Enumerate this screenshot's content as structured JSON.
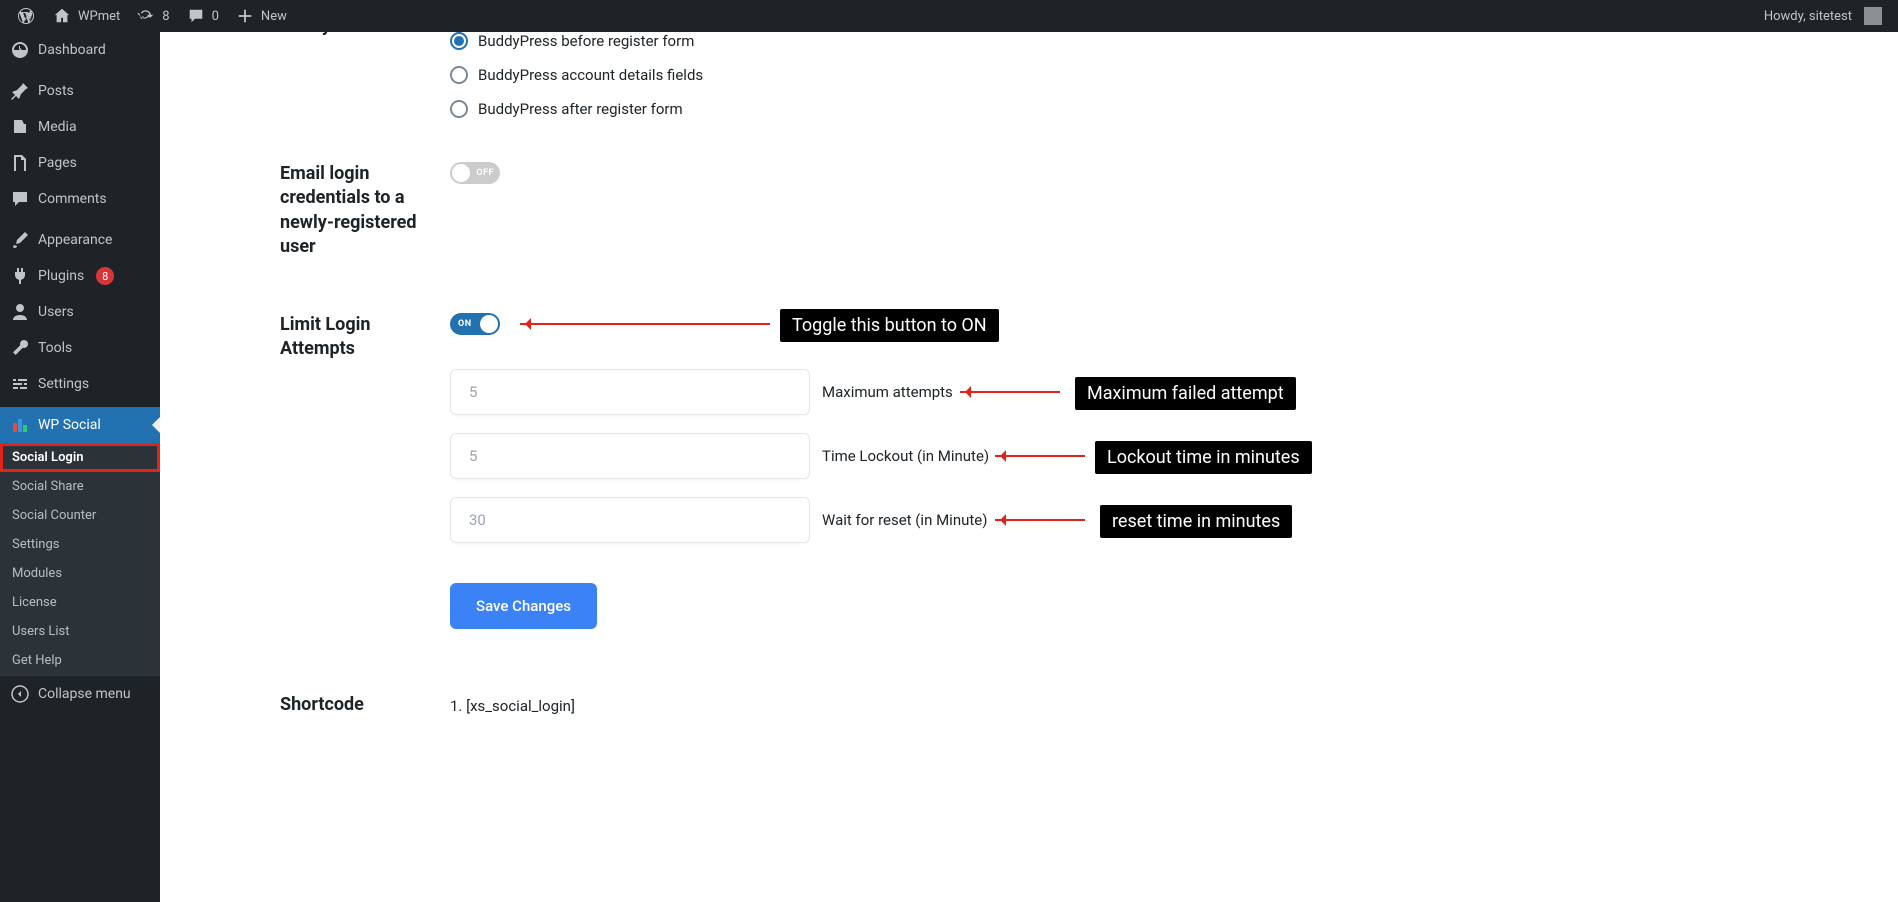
{
  "adminbar": {
    "site_name": "WPmet",
    "updates_count": "8",
    "comments_count": "0",
    "new_label": "New",
    "howdy": "Howdy, sitetest"
  },
  "sidebar": {
    "items": [
      {
        "label": "Dashboard",
        "icon": "dashboard"
      },
      {
        "label": "Posts",
        "icon": "pin"
      },
      {
        "label": "Media",
        "icon": "media"
      },
      {
        "label": "Pages",
        "icon": "pages"
      },
      {
        "label": "Comments",
        "icon": "comment"
      },
      {
        "label": "Appearance",
        "icon": "brush"
      },
      {
        "label": "Plugins",
        "icon": "plug",
        "badge": "8"
      },
      {
        "label": "Users",
        "icon": "user"
      },
      {
        "label": "Tools",
        "icon": "wrench"
      },
      {
        "label": "Settings",
        "icon": "sliders"
      },
      {
        "label": "WP Social",
        "icon": "social",
        "current": true
      }
    ],
    "sub_items": [
      {
        "label": "Social Login",
        "active": true,
        "highlighted": true
      },
      {
        "label": "Social Share"
      },
      {
        "label": "Social Counter"
      },
      {
        "label": "Settings"
      },
      {
        "label": "Modules"
      },
      {
        "label": "License"
      },
      {
        "label": "Users List"
      },
      {
        "label": "Get Help"
      }
    ],
    "collapse_label": "Collapse menu"
  },
  "form": {
    "buddypress_heading": "BuddyPress",
    "bp_option_1": "BuddyPress before register form",
    "bp_option_2": "BuddyPress account details fields",
    "bp_option_3": "BuddyPress after register form",
    "email_login_label": "Email login credentials to a newly-registered user",
    "toggle_off_text": "OFF",
    "limit_login_label": "Limit Login Attempts",
    "toggle_on_text": "ON",
    "max_attempts_placeholder": "5",
    "max_attempts_label": "Maximum attempts",
    "time_lockout_placeholder": "5",
    "time_lockout_label": "Time Lockout (in Minute)",
    "wait_reset_placeholder": "30",
    "wait_reset_label": "Wait for reset (in Minute)",
    "save_button": "Save Changes",
    "shortcode_heading": "Shortcode",
    "shortcode_1": "1. [xs_social_login]"
  },
  "annotations": {
    "toggle_on": "Toggle this button to ON",
    "max_failed": "Maximum failed attempt",
    "lockout_time": "Lockout time in minutes",
    "reset_time": "reset time in minutes"
  }
}
